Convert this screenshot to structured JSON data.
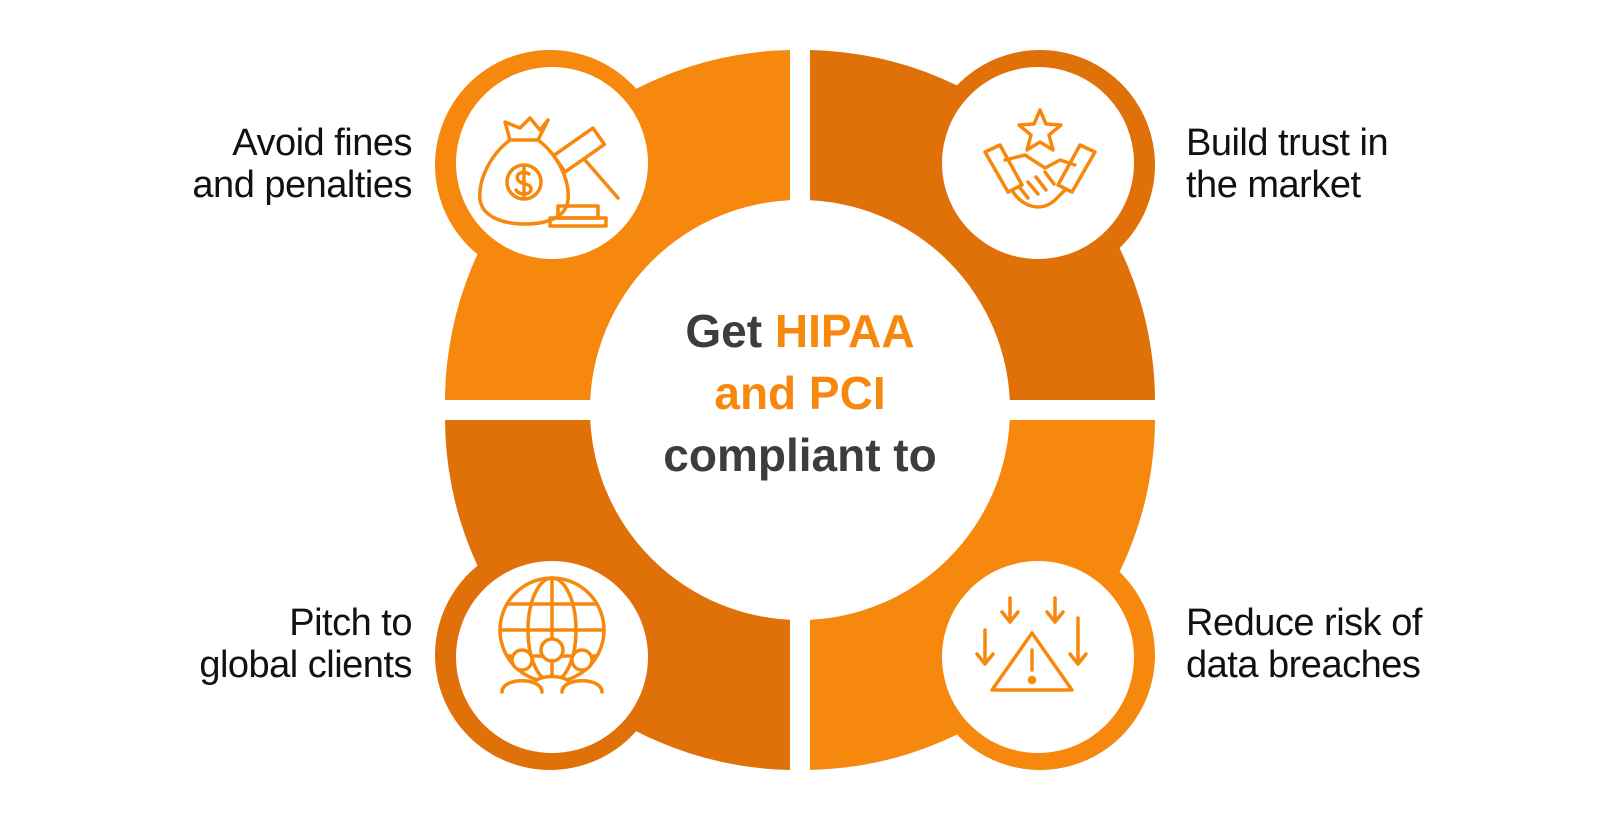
{
  "colors": {
    "orange_light": "#f7880e",
    "orange_dark": "#e07008",
    "text_dark": "#111111",
    "center_text": "#3d3d3d",
    "accent": "#f7880e",
    "background": "#ffffff"
  },
  "center": {
    "line1_plain": "Get",
    "line1_accent": "HIPAA",
    "line2_accent": "and PCI",
    "line3_plain": "compliant to"
  },
  "items": [
    {
      "id": "top-left",
      "line1": "Avoid fines",
      "line2": "and penalties",
      "icon": "money-bag-gavel-icon"
    },
    {
      "id": "top-right",
      "line1": "Build trust in",
      "line2": "the market",
      "icon": "handshake-star-icon"
    },
    {
      "id": "bottom-left",
      "line1": "Pitch to",
      "line2": "global clients",
      "icon": "globe-people-icon"
    },
    {
      "id": "bottom-right",
      "line1": "Reduce risk of",
      "line2": "data breaches",
      "icon": "warning-arrows-icon"
    }
  ]
}
